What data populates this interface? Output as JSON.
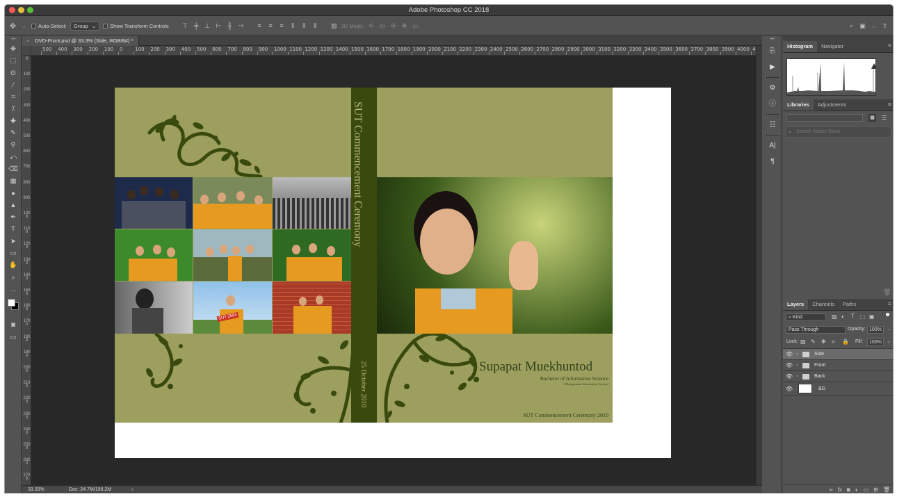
{
  "window": {
    "title": "Adobe Photoshop CC 2018"
  },
  "options": {
    "auto_select_label": "Auto-Select:",
    "auto_select_value": "Group",
    "transform_controls_label": "Show Transform Controls",
    "mode_3d_label": "3D Mode:"
  },
  "document": {
    "tab_title": "DVD-Front.psd @ 33.3% (Side, RGB/8#) *"
  },
  "ruler": {
    "h_labels": [
      "500",
      "400",
      "300",
      "200",
      "100",
      "0",
      "100",
      "200",
      "300",
      "400",
      "500",
      "600",
      "700",
      "800",
      "900",
      "1000",
      "1100",
      "1200",
      "1300",
      "1400",
      "1500",
      "1600",
      "1700",
      "1800",
      "1900",
      "2000",
      "2100",
      "2200",
      "2300",
      "2400",
      "2500",
      "2600",
      "2700",
      "2800",
      "2900",
      "3000",
      "3100",
      "3200",
      "3300",
      "3400",
      "3500",
      "3600",
      "3700",
      "3800",
      "3900",
      "4000",
      "410"
    ]
  },
  "artwork": {
    "spine_title": "SUT Commencement Ceremony",
    "spine_date": "25 October 2010",
    "name": "Supapat Muekhuntod",
    "degree": "Bachelor of Information Science",
    "major": "(Management Information System)",
    "ceremony": "SUT Commencement Ceremony 2010",
    "photo_sign": "SUT 2554"
  },
  "status": {
    "zoom": "33.33%",
    "doc": "Doc: 24.7M/198.2M",
    "arrow": "›"
  },
  "panels": {
    "top_tabs": [
      "Histogram",
      "Navigator"
    ],
    "mid_tabs": [
      "Libraries",
      "Adjustments"
    ],
    "library_search_placeholder": "Search Adobe Stock",
    "layers_tabs": [
      "Layers",
      "Channels",
      "Paths"
    ],
    "kind_label": "Kind",
    "blend_mode": "Pass Through",
    "opacity_label": "Opacity:",
    "opacity_value": "100%",
    "lock_label": "Lock:",
    "fill_label": "Fill:",
    "fill_value": "100%",
    "layers": [
      {
        "name": "Side",
        "type": "group",
        "selected": true
      },
      {
        "name": "Front",
        "type": "group",
        "selected": false
      },
      {
        "name": "Back",
        "type": "group",
        "selected": false
      },
      {
        "name": "BG",
        "type": "layer",
        "selected": false
      }
    ]
  },
  "colors": {
    "cover_green": "#9c9f5e",
    "spine_dark": "#3a4a0e",
    "gown_orange": "#e69a1f",
    "app_bg": "#535353",
    "canvas_bg": "#282828"
  }
}
